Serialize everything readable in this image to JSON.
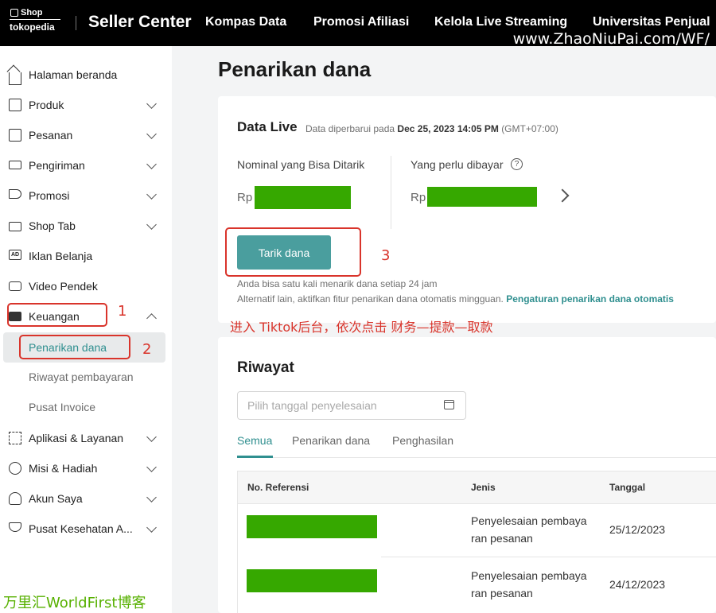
{
  "header": {
    "logo_shop": "Shop",
    "logo_brand": "tokopedia",
    "title": "Seller Center",
    "nav": [
      "Kompas Data",
      "Promosi Afiliasi",
      "Kelola Live Streaming",
      "Universitas Penjual"
    ],
    "watermark_url": "www.ZhaoNiuPai.com/WF/"
  },
  "sidebar": {
    "items": [
      {
        "label": "Halaman beranda",
        "icon": "home-icon"
      },
      {
        "label": "Produk",
        "icon": "box-icon"
      },
      {
        "label": "Pesanan",
        "icon": "clipboard-icon"
      },
      {
        "label": "Pengiriman",
        "icon": "truck-icon"
      },
      {
        "label": "Promosi",
        "icon": "megaphone-icon"
      },
      {
        "label": "Shop Tab",
        "icon": "shopping-bag-icon"
      },
      {
        "label": "Iklan Belanja",
        "icon": "ad-icon"
      },
      {
        "label": "Video Pendek",
        "icon": "video-icon"
      },
      {
        "label": "Keuangan",
        "icon": "wallet-icon"
      },
      {
        "label": "Penarikan dana"
      },
      {
        "label": "Riwayat pembayaran"
      },
      {
        "label": "Pusat Invoice"
      },
      {
        "label": "Aplikasi & Layanan",
        "icon": "apps-grid-icon"
      },
      {
        "label": "Misi & Hadiah",
        "icon": "medal-icon"
      },
      {
        "label": "Akun Saya",
        "icon": "user-icon"
      },
      {
        "label": "Pusat Kesehatan A...",
        "icon": "trophy-icon"
      }
    ]
  },
  "main": {
    "page_title": "Penarikan dana",
    "data_live": {
      "title": "Data Live",
      "updated_prefix": "Data diperbarui pada",
      "updated_time": "Dec 25, 2023 14:05 PM",
      "updated_tz": "(GMT+07:00)",
      "withdrawable_label": "Nominal yang Bisa Ditarik",
      "payable_label": "Yang perlu dibayar",
      "help_glyph": "?",
      "currency": "Rp",
      "withdraw_button": "Tarik dana",
      "note_limit": "Anda bisa satu kali menarik dana setiap 24 jam",
      "note_auto": "Alternatif lain, aktifkan fitur penarikan dana otomatis mingguan.",
      "auto_link": "Pengaturan penarikan dana otomatis"
    },
    "annotations": {
      "step1": "1",
      "step2": "2",
      "step3": "3",
      "instruction": "进入 Tiktok后台，依次点击  财务—提款—取款",
      "accent": "#d9342b"
    },
    "riwayat": {
      "title": "Riwayat",
      "date_placeholder": "Pilih tanggal penyelesaian",
      "tabs": [
        "Semua",
        "Penarikan dana",
        "Penghasilan"
      ],
      "columns": [
        "No. Referensi",
        "Jenis",
        "Tanggal"
      ],
      "rows": [
        {
          "jenis_line1": "Penyelesaian pembaya",
          "jenis_line2": "ran pesanan",
          "tanggal": "25/12/2023"
        },
        {
          "jenis_line1": "Penyelesaian pembaya",
          "jenis_line2": "ran pesanan",
          "tanggal": "24/12/2023"
        }
      ]
    }
  },
  "footer_watermark": "万里汇WorldFirst博客",
  "colors": {
    "accent": "#2f8f8f",
    "button": "#4a9e9e",
    "redaction": "#36a800",
    "watermark_green": "#57b000"
  }
}
